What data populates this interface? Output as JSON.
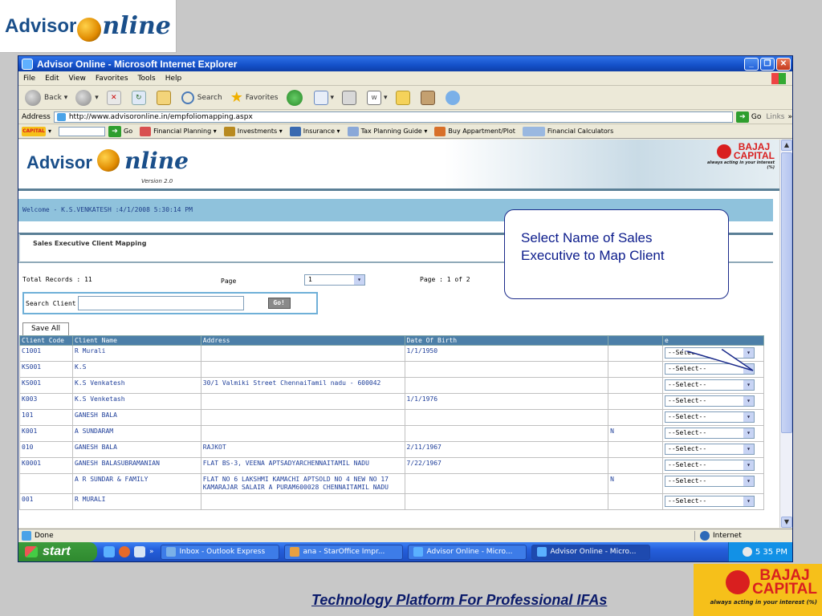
{
  "slide": {
    "logo_advisor": "Advisor",
    "logo_online": "nline",
    "footer_text": "Technology Platform For Professional IFAs",
    "brand_color": "#1a4f8a"
  },
  "window": {
    "title": "Advisor Online - Microsoft Internet Explorer",
    "menu": [
      "File",
      "Edit",
      "View",
      "Favorites",
      "Tools",
      "Help"
    ],
    "toolbar": {
      "back": "Back",
      "search": "Search",
      "favorites": "Favorites"
    },
    "address_label": "Address",
    "url": "http://www.advisoronline.in/empfoliomapping.aspx",
    "go": "Go",
    "links": "Links",
    "links_bar": {
      "brand": "CAPITAL",
      "go": "Go",
      "items": [
        "Financial Planning",
        "Investments",
        "Insurance",
        "Tax Planning Guide",
        "Buy Appartment/Plot",
        "Financial Calculators"
      ]
    },
    "status_done": "Done",
    "status_zone": "Internet"
  },
  "page": {
    "logo_advisor": "Advisor",
    "logo_online": "nline",
    "version": "Version 2.0",
    "bajaj_line1": "BAJAJ",
    "bajaj_line2": "CAPITAL",
    "bajaj_tagline": "always acting in your interest (%)",
    "welcome": "Welcome  -  K.S.VENKATESH :4/1/2008 5:30:14 PM",
    "section_title": "Sales Executive Client Mapping",
    "total_records": "Total Records : 11",
    "page_label": "Page",
    "page_value": "1",
    "page_info": "Page : 1 of 2",
    "search_label": "Search Client",
    "search_value": "",
    "go_button": "Go!",
    "save_all": "Save All",
    "columns": [
      "Client Code",
      "Client Name",
      "Address",
      "Date Of Birth",
      "",
      "e"
    ],
    "rows": [
      {
        "code": "C1001",
        "name": "R Murali",
        "address": "",
        "dob": "1/1/1950",
        "flag": "",
        "select": "--Select--"
      },
      {
        "code": "KS001",
        "name": "K.S",
        "address": "",
        "dob": "",
        "flag": "",
        "select": "--Select--"
      },
      {
        "code": "KS001",
        "name": "K.S Venkatesh",
        "address": "30/1 Valmiki Street ChennaiTamil nadu - 600042",
        "dob": "",
        "flag": "",
        "select": "--Select--"
      },
      {
        "code": "K003",
        "name": "K.S Venketash",
        "address": "",
        "dob": "1/1/1976",
        "flag": "",
        "select": "--Select--"
      },
      {
        "code": "101",
        "name": "GANESH BALA",
        "address": "",
        "dob": "",
        "flag": "",
        "select": "--Select--"
      },
      {
        "code": "K001",
        "name": "A SUNDARAM",
        "address": "",
        "dob": "",
        "flag": "N",
        "select": "--Select--"
      },
      {
        "code": "010",
        "name": "GANESH BALA",
        "address": "RAJKOT",
        "dob": "2/11/1967",
        "flag": "",
        "select": "--Select--"
      },
      {
        "code": "K0001",
        "name": "GANESH BALASUBRAMANIAN",
        "address": "FLAT BS-3, VEENA APTSADYARCHENNAITAMIL NADU",
        "dob": "7/22/1967",
        "flag": "",
        "select": "--Select--"
      },
      {
        "code": "",
        "name": "A R SUNDAR & FAMILY",
        "address": "FLAT NO 6 LAKSHMI KAMACHI APTSOLD NO 4 NEW NO 17 KAMARAJAR SALAIR A PURAM600028 CHENNAITAMIL NADU",
        "dob": "",
        "flag": "N",
        "select": "--Select--"
      },
      {
        "code": "001",
        "name": "R MURALI",
        "address": "",
        "dob": "",
        "flag": "",
        "select": "--Select--"
      }
    ]
  },
  "callout": {
    "line1": "Select  Name of  Sales",
    "line2": "Executive to Map Client"
  },
  "taskbar": {
    "start": "start",
    "tasks": [
      "Inbox - Outlook Express",
      "ana - StarOffice Impr...",
      "Advisor Online - Micro...",
      "Advisor Online - Micro..."
    ],
    "clock": "5 35 PM"
  },
  "colors": {
    "header_bg": "#4c7fa8",
    "welcome_bg": "#8fc2dc",
    "bajaj_red": "#d91f1f",
    "bajaj_yellow": "#f6c01a",
    "callout_text": "#0b1b8b"
  }
}
